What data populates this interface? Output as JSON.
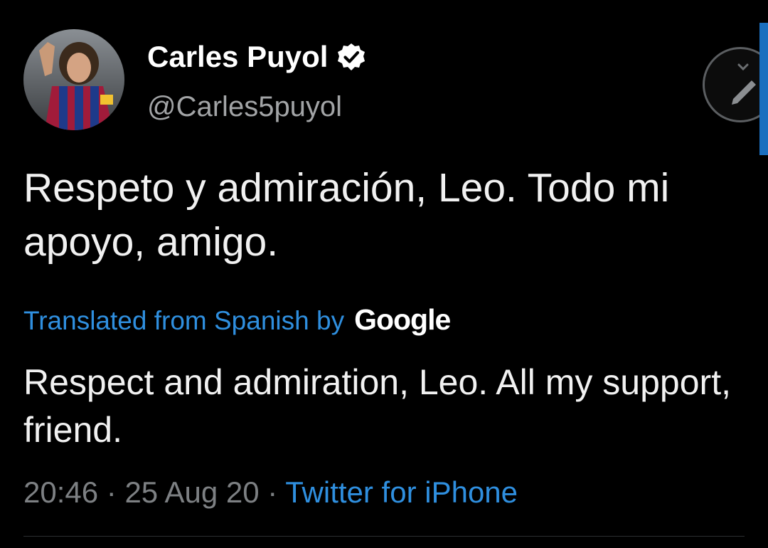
{
  "author": {
    "display_name": "Carles Puyol",
    "handle": "@Carles5puyol",
    "verified": true,
    "avatar_icon": "profile-photo"
  },
  "tweet": {
    "text": "Respeto y admiración, Leo. Todo mi apoyo, amigo.",
    "translation_label": "Translated from Spanish by",
    "translation_provider": "Google",
    "translated_text": "Respect and admiration, Leo. All my support, friend.",
    "time": "20:46",
    "date": "25 Aug 20",
    "separator": " · ",
    "source": "Twitter for iPhone"
  },
  "colors": {
    "background": "#000000",
    "link": "#2f8fdf",
    "muted": "#7d8083",
    "scroll_indicator": "#1b6fbf"
  },
  "icons": {
    "verified": "verified-badge-icon",
    "compose": "pencil-icon"
  }
}
